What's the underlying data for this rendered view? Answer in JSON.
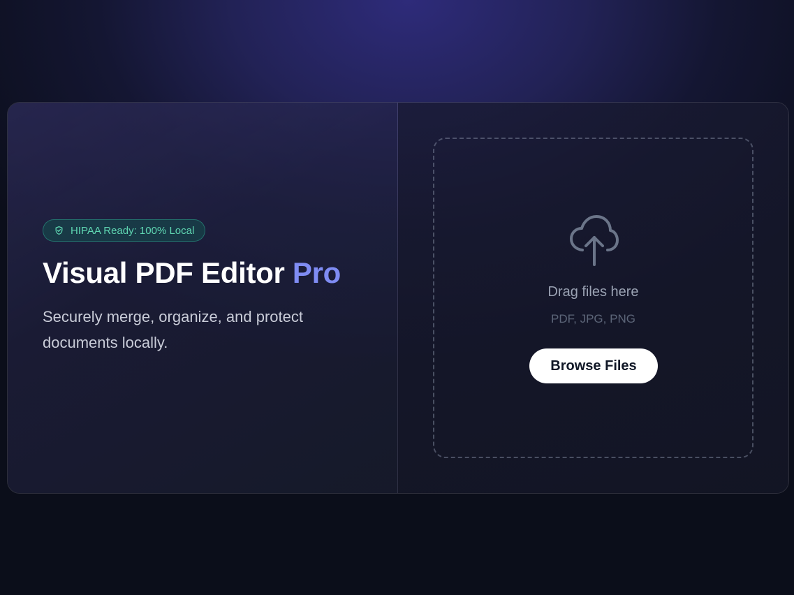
{
  "hero": {
    "badge_text": "HIPAA Ready: 100% Local",
    "badge_icon": "shield-check-icon",
    "title_main": "Visual PDF Editor ",
    "title_accent": "Pro",
    "subtitle": "Securely merge, organize, and protect documents locally."
  },
  "upload": {
    "icon": "cloud-upload-icon",
    "drag_text": "Drag files here",
    "file_types": "PDF, JPG, PNG",
    "browse_label": "Browse Files"
  },
  "colors": {
    "accent": "#7f8cf3",
    "badge_text": "#5fd6b2",
    "button_bg": "#ffffff",
    "button_text": "#111827"
  }
}
